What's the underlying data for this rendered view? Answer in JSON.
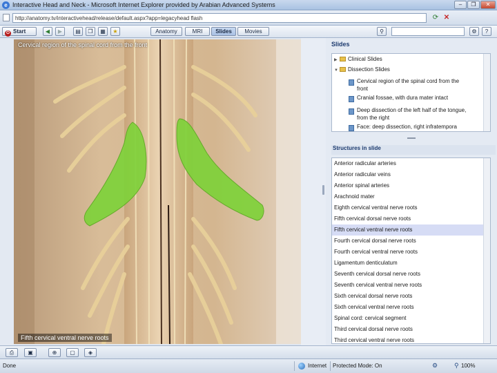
{
  "window": {
    "title": "Interactive Head and Neck - Microsoft Internet Explorer provided by Arabian Advanced Systems",
    "minimize": "–",
    "restore": "❐",
    "close": "✕"
  },
  "address": {
    "url": "http://anatomy.tv/interactivehead/release/default.aspx?app=legacyhead flash"
  },
  "toolbar": {
    "start_label": "Start",
    "tabs": [
      {
        "label": "Anatomy"
      },
      {
        "label": "MRI"
      },
      {
        "label": "Slides"
      },
      {
        "label": "Movies"
      }
    ],
    "active_tab": "Slides"
  },
  "image": {
    "caption_top": "Cervical region of the spinal cord from the front",
    "caption_bottom": "Fifth cervical ventral nerve roots",
    "highlight_color": "#7fd23a"
  },
  "slides_panel": {
    "header": "Slides",
    "folders": [
      {
        "label": "Clinical Slides"
      },
      {
        "label": "Dissection Slides"
      }
    ],
    "items": [
      {
        "label_line1": "Cervical region of the spinal cord from the",
        "label_line2": "front"
      },
      {
        "label_line1": "Cranial fossae, with dura mater intact",
        "label_line2": ""
      },
      {
        "label_line1": "Deep dissection of the left half of the tongue,",
        "label_line2": "from the right"
      },
      {
        "label_line1": "Face: deep dissection, right infratempora",
        "label_line2": ""
      }
    ]
  },
  "structures_panel": {
    "header": "Structures in slide",
    "items": [
      {
        "label": "Anterior radicular arteries"
      },
      {
        "label": "Anterior radicular veins"
      },
      {
        "label": "Anterior spinal arteries"
      },
      {
        "label": "Arachnoid mater"
      },
      {
        "label": "Eighth cervical ventral nerve roots"
      },
      {
        "label": "Fifth cervical dorsal nerve roots"
      },
      {
        "label": "Fifth cervical ventral nerve roots"
      },
      {
        "label": "Fourth cervical dorsal nerve roots"
      },
      {
        "label": "Fourth cervical ventral nerve roots"
      },
      {
        "label": "Ligamentum denticulatum"
      },
      {
        "label": "Seventh cervical dorsal nerve roots"
      },
      {
        "label": "Seventh cervical ventral nerve roots"
      },
      {
        "label": "Sixth cervical dorsal nerve roots"
      },
      {
        "label": "Sixth cervical ventral nerve roots"
      },
      {
        "label": "Spinal cord: cervical segment"
      },
      {
        "label": "Third cervical dorsal nerve roots"
      },
      {
        "label": "Third cervical ventral nerve roots"
      }
    ],
    "selected_index": 6
  },
  "status": {
    "text": "Done",
    "zone": "Internet",
    "mode": "Protected Mode: On",
    "zoom": "100%"
  }
}
